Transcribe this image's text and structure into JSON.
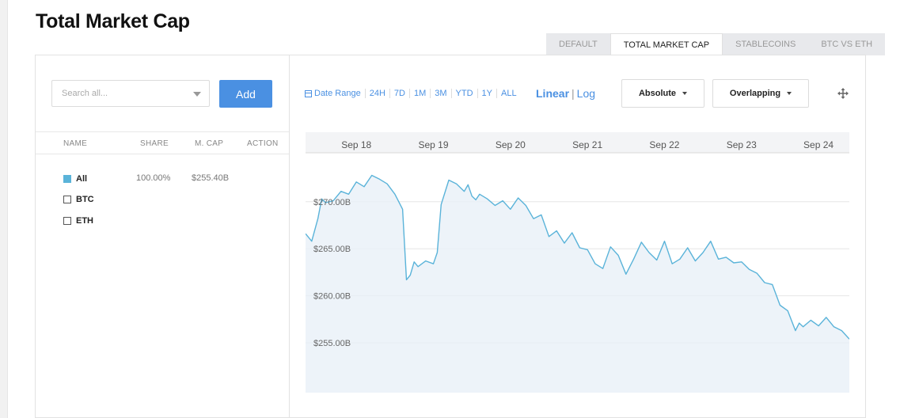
{
  "page": {
    "title": "Total Market Cap"
  },
  "tabs": [
    {
      "label": "DEFAULT",
      "active": false
    },
    {
      "label": "TOTAL MARKET CAP",
      "active": true
    },
    {
      "label": "STABLECOINS",
      "active": false
    },
    {
      "label": "BTC VS ETH",
      "active": false
    }
  ],
  "sidebar": {
    "search_placeholder": "Search all...",
    "add_label": "Add",
    "columns": {
      "name": "NAME",
      "share": "SHARE",
      "mcap": "M. CAP",
      "action": "ACTION"
    },
    "rows": [
      {
        "name": "All",
        "checked": true,
        "share": "100.00%",
        "mcap": "$255.40B"
      },
      {
        "name": "BTC",
        "checked": false,
        "share": "",
        "mcap": ""
      },
      {
        "name": "ETH",
        "checked": false,
        "share": "",
        "mcap": ""
      }
    ]
  },
  "controls": {
    "ranges": [
      "Date Range",
      "24H",
      "7D",
      "1M",
      "3M",
      "YTD",
      "1Y",
      "ALL"
    ],
    "scale_linear": "Linear",
    "scale_sep": "|",
    "scale_log": "Log",
    "mode": "Absolute",
    "layout": "Overlapping"
  },
  "colors": {
    "accent": "#4a90e2",
    "line": "#5ab3d9",
    "area": "#e8f0f7",
    "checkbox": "#5ab3d9"
  },
  "chart_data": {
    "type": "area",
    "x_ticks": [
      "Sep 18",
      "Sep 19",
      "Sep 20",
      "Sep 21",
      "Sep 22",
      "Sep 23",
      "Sep 24"
    ],
    "y_ticks": [
      "$270.00B",
      "$265.00B",
      "$260.00B",
      "$255.00B"
    ],
    "y_tick_values": [
      270,
      265,
      260,
      255
    ],
    "ylim": [
      249.7,
      275.2
    ],
    "x_range": [
      17.34,
      24.4
    ],
    "grid": true,
    "series": [
      {
        "x": [
          17.34,
          17.42,
          17.5,
          17.55,
          17.6,
          17.7,
          17.8,
          17.9,
          18.0,
          18.1,
          18.2,
          18.3,
          18.4,
          18.5,
          18.6,
          18.65,
          18.7,
          18.75,
          18.8,
          18.9,
          19.0,
          19.05,
          19.1,
          19.2,
          19.3,
          19.4,
          19.45,
          19.5,
          19.55,
          19.6,
          19.7,
          19.8,
          19.9,
          20.0,
          20.1,
          20.2,
          20.3,
          20.4,
          20.5,
          20.6,
          20.7,
          20.8,
          20.9,
          21.0,
          21.1,
          21.2,
          21.3,
          21.4,
          21.5,
          21.6,
          21.7,
          21.8,
          21.9,
          22.0,
          22.1,
          22.2,
          22.3,
          22.4,
          22.5,
          22.6,
          22.7,
          22.8,
          22.9,
          23.0,
          23.1,
          23.2,
          23.3,
          23.4,
          23.5,
          23.6,
          23.7,
          23.75,
          23.8,
          23.9,
          24.0,
          24.1,
          24.2,
          24.3,
          24.4
        ],
        "y": [
          266.6,
          265.8,
          268.2,
          270.3,
          269.9,
          270.1,
          271.1,
          270.8,
          272.1,
          271.6,
          272.8,
          272.4,
          271.9,
          270.8,
          269.2,
          261.7,
          262.2,
          263.6,
          263.1,
          263.7,
          263.4,
          264.6,
          269.7,
          272.3,
          271.9,
          271.1,
          271.8,
          270.6,
          270.2,
          270.8,
          270.3,
          269.6,
          270.1,
          269.2,
          270.4,
          269.6,
          268.2,
          268.6,
          266.3,
          266.9,
          265.6,
          266.7,
          265.1,
          264.9,
          263.4,
          262.9,
          265.2,
          264.3,
          262.3,
          263.9,
          265.7,
          264.6,
          263.8,
          265.8,
          263.4,
          263.9,
          265.1,
          263.7,
          264.6,
          265.8,
          263.9,
          264.1,
          263.5,
          263.6,
          262.8,
          262.4,
          261.4,
          261.2,
          259.0,
          258.4,
          256.3,
          257.1,
          256.7,
          257.4,
          256.8,
          257.7,
          256.7,
          256.3,
          255.4
        ]
      }
    ]
  }
}
